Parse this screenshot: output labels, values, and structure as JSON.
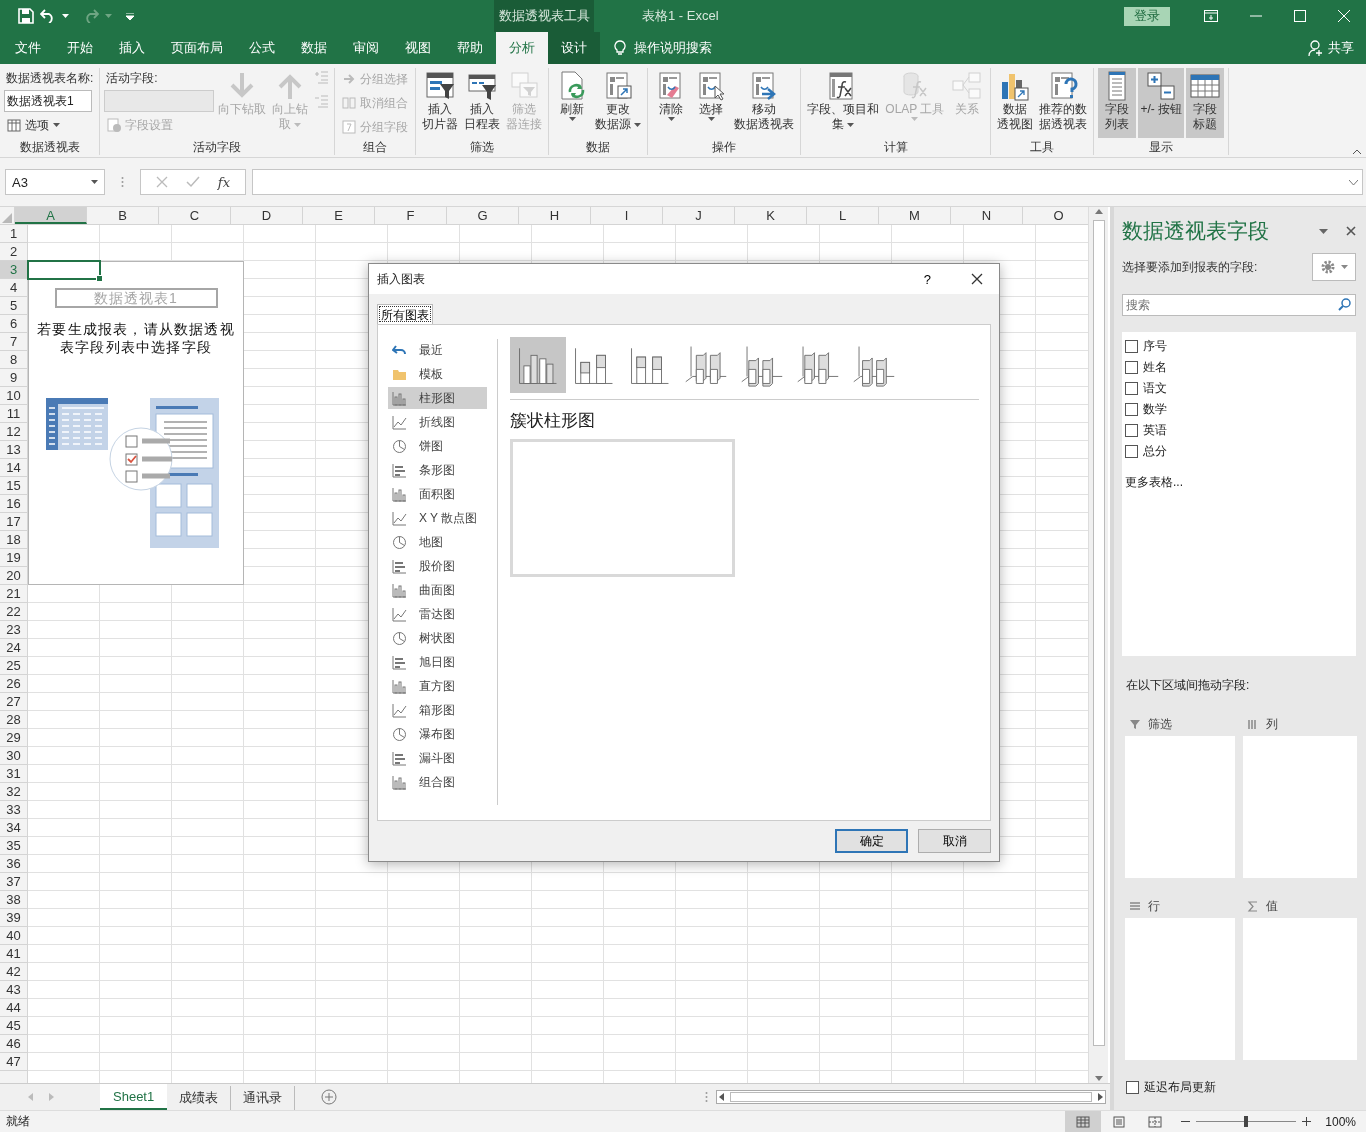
{
  "title_bar": {
    "context_label": "数据透视表工具",
    "document_title": "表格1  -  Excel",
    "sign_in": "登录"
  },
  "menu_tabs": [
    {
      "label": "文件",
      "selected": false,
      "contextual": false
    },
    {
      "label": "开始",
      "selected": false,
      "contextual": false
    },
    {
      "label": "插入",
      "selected": false,
      "contextual": false
    },
    {
      "label": "页面布局",
      "selected": false,
      "contextual": false
    },
    {
      "label": "公式",
      "selected": false,
      "contextual": false
    },
    {
      "label": "数据",
      "selected": false,
      "contextual": false
    },
    {
      "label": "审阅",
      "selected": false,
      "contextual": false
    },
    {
      "label": "视图",
      "selected": false,
      "contextual": false
    },
    {
      "label": "帮助",
      "selected": false,
      "contextual": false
    },
    {
      "label": "分析",
      "selected": true,
      "contextual": true
    },
    {
      "label": "设计",
      "selected": false,
      "contextual": true
    }
  ],
  "tell_me": "操作说明搜索",
  "share": "共享",
  "ribbon_groups": [
    {
      "label": "数据透视表",
      "columns": [
        [
          {
            "kind": "caption",
            "label": "数据透视表名称:"
          },
          {
            "kind": "field",
            "value": "数据透视表1",
            "disabled": false
          },
          {
            "kind": "small",
            "label": "选项",
            "dropdown": true,
            "disabled": false
          }
        ]
      ]
    },
    {
      "label": "活动字段",
      "columns": [
        [
          {
            "kind": "caption",
            "label": "活动字段:"
          },
          {
            "kind": "field",
            "disabled": true
          },
          {
            "kind": "small",
            "label": "字段设置",
            "dropdown": false,
            "disabled": true
          }
        ],
        [
          {
            "kind": "large",
            "lines": [
              "向下钻取"
            ],
            "dropdown": false,
            "disabled": true
          }
        ],
        [
          {
            "kind": "large",
            "lines": [
              "向上钻",
              "取"
            ],
            "dropdown": true,
            "disabled": true
          }
        ],
        [
          {
            "kind": "icon",
            "disabled": true
          },
          {
            "kind": "icon",
            "disabled": true
          }
        ]
      ]
    },
    {
      "label": "组合",
      "columns": [
        [
          {
            "kind": "small",
            "label": "分组选择",
            "dropdown": false,
            "disabled": true
          },
          {
            "kind": "small",
            "label": "取消组合",
            "dropdown": false,
            "disabled": true
          },
          {
            "kind": "small",
            "label": "分组字段",
            "dropdown": false,
            "disabled": true
          }
        ]
      ]
    },
    {
      "label": "筛选",
      "columns": [
        [
          {
            "kind": "large",
            "lines": [
              "插入",
              "切片器"
            ],
            "dropdown": false,
            "disabled": false
          }
        ],
        [
          {
            "kind": "large",
            "lines": [
              "插入",
              "日程表"
            ],
            "dropdown": false,
            "disabled": false
          }
        ],
        [
          {
            "kind": "large",
            "lines": [
              "筛选",
              "器连接"
            ],
            "dropdown": false,
            "disabled": true
          }
        ]
      ]
    },
    {
      "label": "数据",
      "columns": [
        [
          {
            "kind": "large",
            "lines": [
              "刷新"
            ],
            "dropdown": true,
            "disabled": false
          }
        ],
        [
          {
            "kind": "large",
            "lines": [
              "更改",
              "数据源"
            ],
            "dropdown": true,
            "disabled": false
          }
        ]
      ]
    },
    {
      "label": "操作",
      "columns": [
        [
          {
            "kind": "large",
            "lines": [
              "清除"
            ],
            "dropdown": true,
            "disabled": false
          }
        ],
        [
          {
            "kind": "large",
            "lines": [
              "选择"
            ],
            "dropdown": true,
            "disabled": false
          }
        ],
        [
          {
            "kind": "large",
            "lines": [
              "移动",
              "数据透视表"
            ],
            "dropdown": false,
            "disabled": false
          }
        ]
      ]
    },
    {
      "label": "计算",
      "columns": [
        [
          {
            "kind": "large",
            "lines": [
              "字段、项目和",
              "集"
            ],
            "dropdown": true,
            "disabled": false
          }
        ],
        [
          {
            "kind": "large",
            "lines": [
              "OLAP 工具"
            ],
            "dropdown": true,
            "disabled": true
          }
        ],
        [
          {
            "kind": "large",
            "lines": [
              "关系"
            ],
            "dropdown": false,
            "disabled": true
          }
        ]
      ]
    },
    {
      "label": "工具",
      "columns": [
        [
          {
            "kind": "large",
            "lines": [
              "数据",
              "透视图"
            ],
            "dropdown": false,
            "disabled": false
          }
        ],
        [
          {
            "kind": "large",
            "lines": [
              "推荐的数",
              "据透视表"
            ],
            "dropdown": false,
            "disabled": false
          }
        ]
      ]
    },
    {
      "label": "显示",
      "columns": [
        [
          {
            "kind": "large",
            "lines": [
              "字段",
              "列表"
            ],
            "dropdown": false,
            "disabled": false,
            "on": true
          }
        ],
        [
          {
            "kind": "large",
            "lines": [
              "+/- 按钮"
            ],
            "dropdown": false,
            "disabled": false,
            "on": true
          }
        ],
        [
          {
            "kind": "large",
            "lines": [
              "字段",
              "标题"
            ],
            "dropdown": false,
            "disabled": false,
            "on": true
          }
        ]
      ]
    }
  ],
  "formula_bar": {
    "name_box": "A3",
    "function_label": "fx"
  },
  "grid": {
    "columns": [
      {
        "label": "A",
        "selected": true
      },
      {
        "label": "B",
        "selected": false
      },
      {
        "label": "C",
        "selected": false
      },
      {
        "label": "D",
        "selected": false
      },
      {
        "label": "E",
        "selected": false
      },
      {
        "label": "F",
        "selected": false
      },
      {
        "label": "G",
        "selected": false
      },
      {
        "label": "H",
        "selected": false
      },
      {
        "label": "I",
        "selected": false
      },
      {
        "label": "J",
        "selected": false
      },
      {
        "label": "K",
        "selected": false
      },
      {
        "label": "L",
        "selected": false
      },
      {
        "label": "M",
        "selected": false
      },
      {
        "label": "N",
        "selected": false
      },
      {
        "label": "O",
        "selected": false
      }
    ],
    "rows": [
      {
        "label": "1",
        "selected": false
      },
      {
        "label": "2",
        "selected": false
      },
      {
        "label": "3",
        "selected": true
      },
      {
        "label": "4",
        "selected": false
      },
      {
        "label": "5",
        "selected": false
      },
      {
        "label": "6",
        "selected": false
      },
      {
        "label": "7",
        "selected": false
      },
      {
        "label": "8",
        "selected": false
      },
      {
        "label": "9",
        "selected": false
      },
      {
        "label": "10",
        "selected": false
      },
      {
        "label": "11",
        "selected": false
      },
      {
        "label": "12",
        "selected": false
      },
      {
        "label": "13",
        "selected": false
      },
      {
        "label": "14",
        "selected": false
      },
      {
        "label": "15",
        "selected": false
      },
      {
        "label": "16",
        "selected": false
      },
      {
        "label": "17",
        "selected": false
      },
      {
        "label": "18",
        "selected": false
      },
      {
        "label": "19",
        "selected": false
      },
      {
        "label": "20",
        "selected": false
      },
      {
        "label": "21",
        "selected": false
      },
      {
        "label": "22",
        "selected": false
      },
      {
        "label": "23",
        "selected": false
      },
      {
        "label": "24",
        "selected": false
      },
      {
        "label": "25",
        "selected": false
      },
      {
        "label": "26",
        "selected": false
      },
      {
        "label": "27",
        "selected": false
      },
      {
        "label": "28",
        "selected": false
      },
      {
        "label": "29",
        "selected": false
      },
      {
        "label": "30",
        "selected": false
      },
      {
        "label": "31",
        "selected": false
      },
      {
        "label": "32",
        "selected": false
      },
      {
        "label": "33",
        "selected": false
      },
      {
        "label": "34",
        "selected": false
      },
      {
        "label": "35",
        "selected": false
      },
      {
        "label": "36",
        "selected": false
      },
      {
        "label": "37",
        "selected": false
      },
      {
        "label": "38",
        "selected": false
      },
      {
        "label": "39",
        "selected": false
      },
      {
        "label": "40",
        "selected": false
      },
      {
        "label": "41",
        "selected": false
      },
      {
        "label": "42",
        "selected": false
      },
      {
        "label": "43",
        "selected": false
      },
      {
        "label": "44",
        "selected": false
      },
      {
        "label": "45",
        "selected": false
      },
      {
        "label": "46",
        "selected": false
      },
      {
        "label": "47",
        "selected": false
      }
    ]
  },
  "pivot_placeholder": {
    "name": "数据透视表1",
    "message": "若要生成报表，请从数据透视表字段列表中选择字段"
  },
  "dialog": {
    "title": "插入图表",
    "help": "?",
    "tabs": [
      {
        "label": "所有图表",
        "selected": true
      }
    ],
    "categories": [
      {
        "label": "最近",
        "selected": false
      },
      {
        "label": "模板",
        "selected": false
      },
      {
        "label": "柱形图",
        "selected": true
      },
      {
        "label": "折线图",
        "selected": false
      },
      {
        "label": "饼图",
        "selected": false
      },
      {
        "label": "条形图",
        "selected": false
      },
      {
        "label": "面积图",
        "selected": false
      },
      {
        "label": "X Y 散点图",
        "selected": false
      },
      {
        "label": "地图",
        "selected": false
      },
      {
        "label": "股价图",
        "selected": false
      },
      {
        "label": "曲面图",
        "selected": false
      },
      {
        "label": "雷达图",
        "selected": false
      },
      {
        "label": "树状图",
        "selected": false
      },
      {
        "label": "旭日图",
        "selected": false
      },
      {
        "label": "直方图",
        "selected": false
      },
      {
        "label": "箱形图",
        "selected": false
      },
      {
        "label": "瀑布图",
        "selected": false
      },
      {
        "label": "漏斗图",
        "selected": false
      },
      {
        "label": "组合图",
        "selected": false
      }
    ],
    "subtypes": [
      {
        "selected": true
      },
      {
        "selected": false
      },
      {
        "selected": false
      },
      {
        "selected": false
      },
      {
        "selected": false
      },
      {
        "selected": false
      },
      {
        "selected": false
      }
    ],
    "subtype_title": "簇状柱形图",
    "buttons": [
      {
        "label": "确定",
        "default": true
      },
      {
        "label": "取消",
        "default": false
      }
    ]
  },
  "pane": {
    "title": "数据透视表字段",
    "subtitle": "选择要添加到报表的字段:",
    "search_placeholder": "搜索",
    "fields": [
      {
        "label": "序号",
        "checked": false
      },
      {
        "label": "姓名",
        "checked": false
      },
      {
        "label": "语文",
        "checked": false
      },
      {
        "label": "数学",
        "checked": false
      },
      {
        "label": "英语",
        "checked": false
      },
      {
        "label": "总分",
        "checked": false
      }
    ],
    "more_tables": "更多表格...",
    "areas_caption": "在以下区域间拖动字段:",
    "areas": [
      {
        "label": "筛选"
      },
      {
        "label": "列"
      },
      {
        "label": "行"
      },
      {
        "label": "值"
      }
    ],
    "defer_update": {
      "label": "延迟布局更新",
      "checked": false
    }
  },
  "sheet_tabs": [
    {
      "label": "Sheet1",
      "selected": true
    },
    {
      "label": "成绩表",
      "selected": false
    },
    {
      "label": "通讯录",
      "selected": false
    }
  ],
  "status_bar": {
    "status": "就绪",
    "views": [
      {
        "selected": true
      },
      {
        "selected": false
      },
      {
        "selected": false
      }
    ],
    "zoom": {
      "level": 0.5,
      "reading": "100%"
    }
  }
}
